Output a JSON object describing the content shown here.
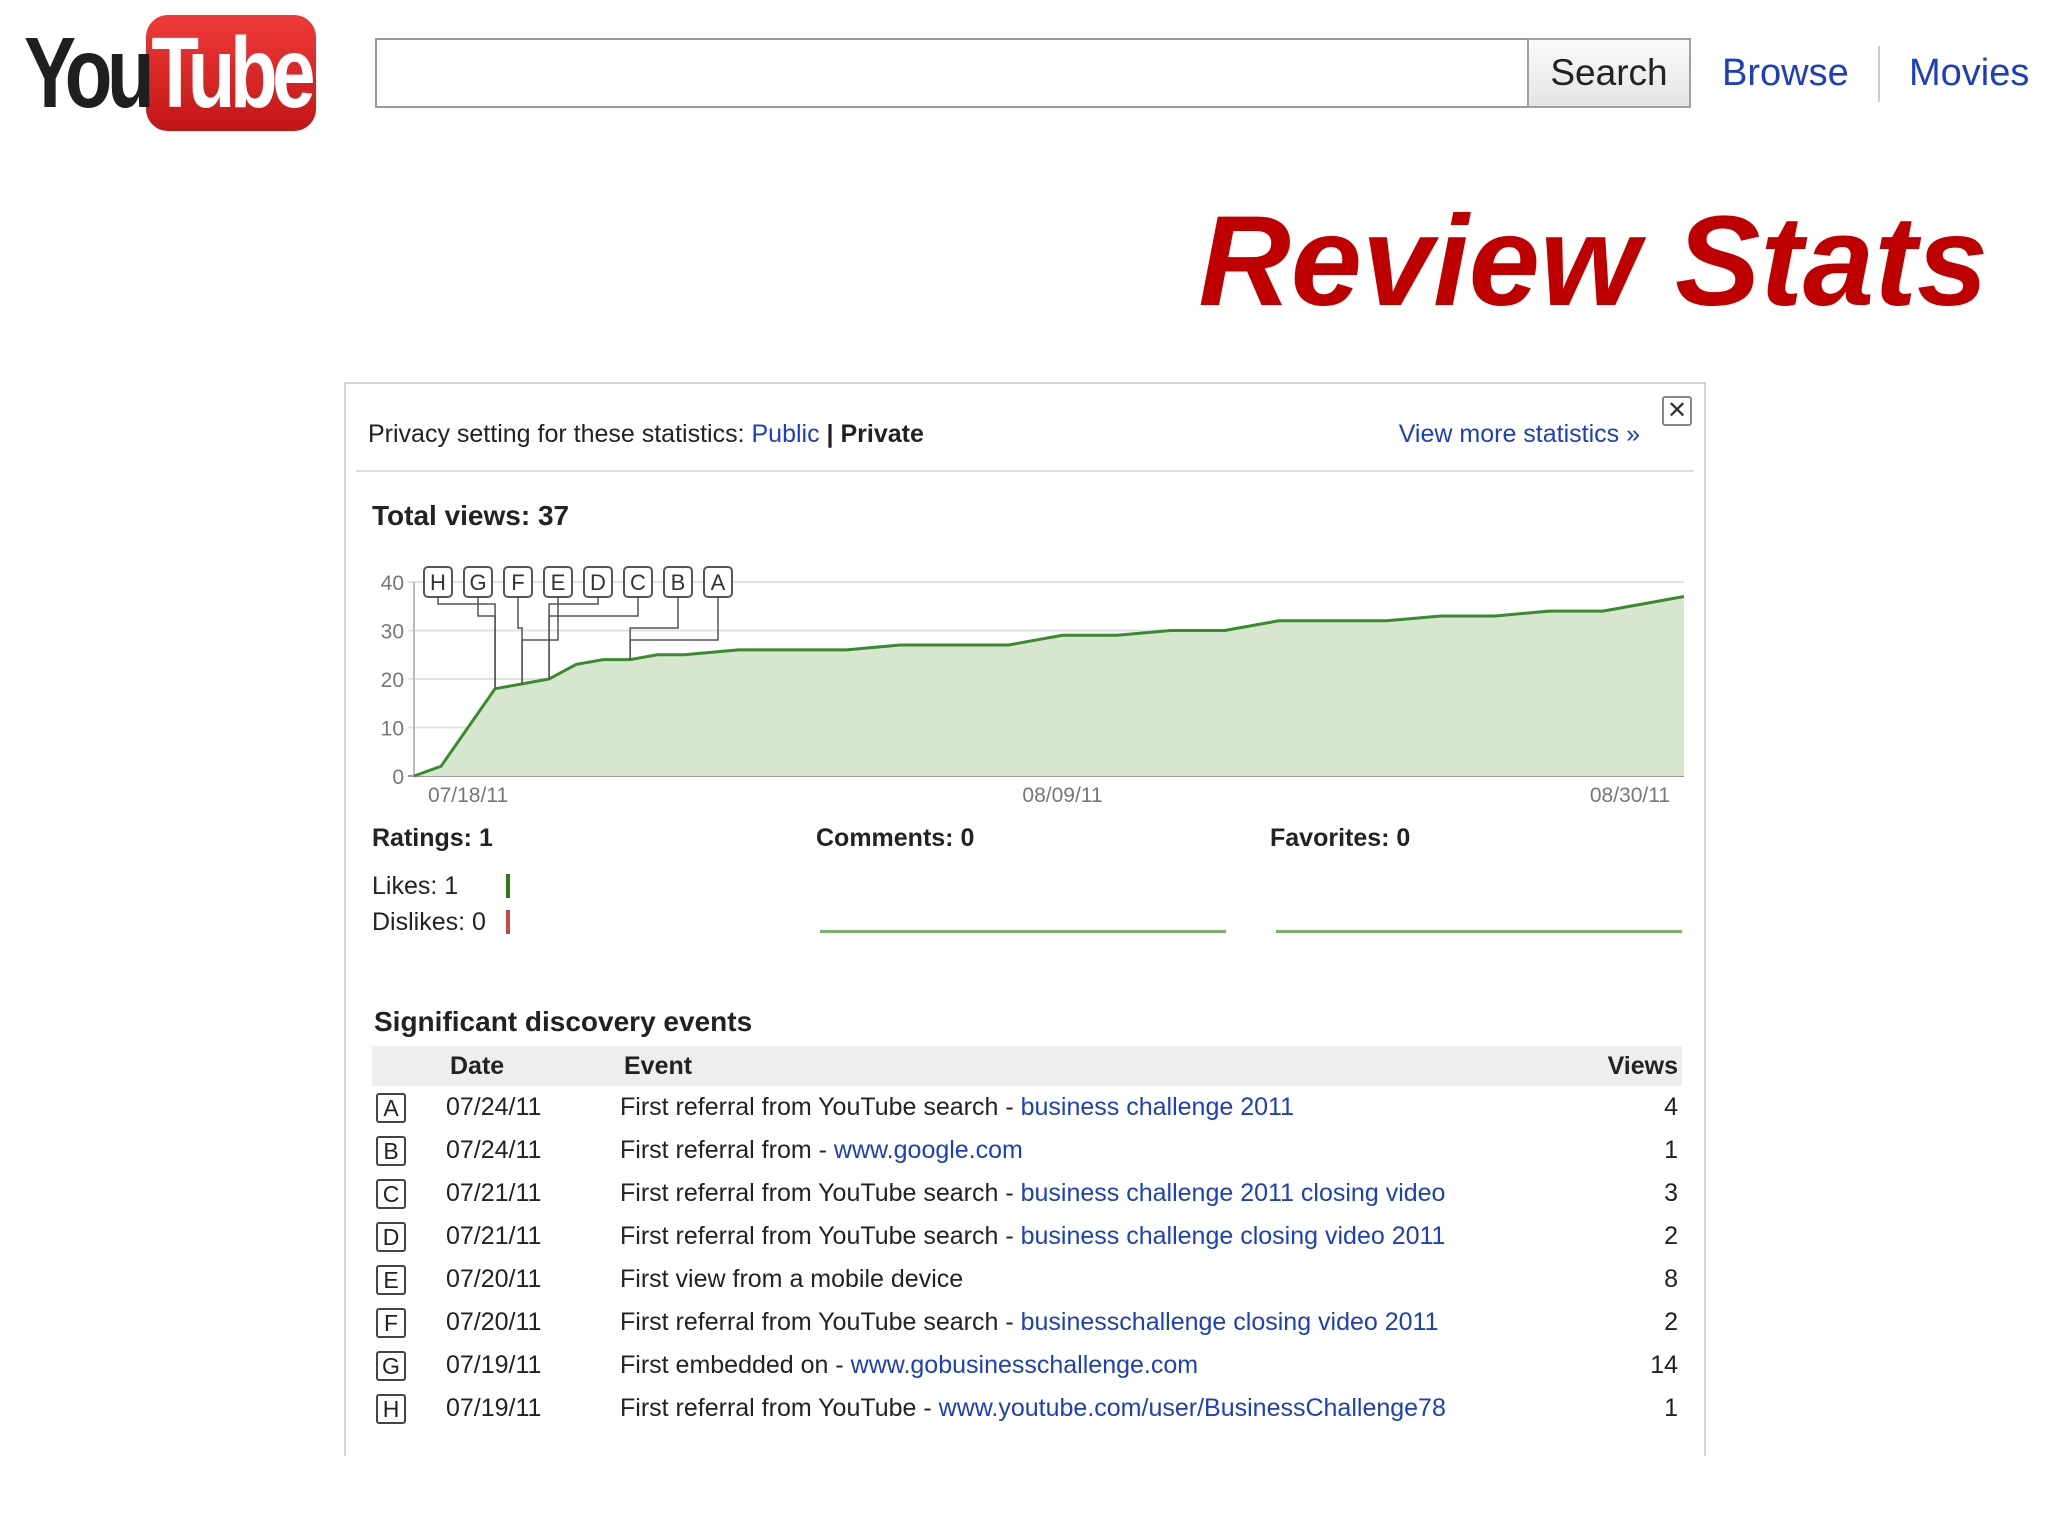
{
  "header": {
    "logo_you": "You",
    "logo_tube": "Tube",
    "search_button": "Search",
    "search_value": "",
    "nav": [
      "Browse",
      "Movies"
    ]
  },
  "slide_title": "Review Stats",
  "panel": {
    "privacy_label": "Privacy setting for these statistics:",
    "privacy_public": "Public",
    "privacy_sep": "|",
    "privacy_private": "Private",
    "view_more": "View more statistics »",
    "close": "✕",
    "total_views": "Total views: 37",
    "ratings": "Ratings: 1",
    "likes": "Likes: 1",
    "dislikes": "Dislikes: 0",
    "comments": "Comments: 0",
    "favorites": "Favorites: 0",
    "events_title": "Significant discovery events",
    "events_columns": {
      "date": "Date",
      "event": "Event",
      "views": "Views"
    },
    "events": [
      {
        "letter": "A",
        "date": "07/24/11",
        "text": "First referral from YouTube search - ",
        "link": "business challenge 2011",
        "views": "4"
      },
      {
        "letter": "B",
        "date": "07/24/11",
        "text": "First referral from - ",
        "link": "www.google.com",
        "views": "1"
      },
      {
        "letter": "C",
        "date": "07/21/11",
        "text": "First referral from YouTube search - ",
        "link": "business challenge 2011 closing video",
        "views": "3"
      },
      {
        "letter": "D",
        "date": "07/21/11",
        "text": "First referral from YouTube search - ",
        "link": "business challenge closing video 2011",
        "views": "2"
      },
      {
        "letter": "E",
        "date": "07/20/11",
        "text": "First view from a mobile device",
        "link": "",
        "views": "8"
      },
      {
        "letter": "F",
        "date": "07/20/11",
        "text": "First referral from YouTube search - ",
        "link": "businesschallenge closing video 2011",
        "views": "2"
      },
      {
        "letter": "G",
        "date": "07/19/11",
        "text": "First embedded on - ",
        "link": "www.gobusinesschallenge.com",
        "views": "14"
      },
      {
        "letter": "H",
        "date": "07/19/11",
        "text": "First referral from YouTube - ",
        "link": "www.youtube.com/user/BusinessChallenge78",
        "views": "1"
      }
    ]
  },
  "chart_data": {
    "type": "area",
    "title": "",
    "xlabel": "",
    "ylabel": "",
    "ylim": [
      0,
      40
    ],
    "yticks": [
      0,
      10,
      20,
      30,
      40
    ],
    "xticks": [
      "07/18/11",
      "08/09/11",
      "08/30/11"
    ],
    "grid": true,
    "colors": {
      "line": "#3a8a2e",
      "fill": "#d6e6cf"
    },
    "markers": [
      "H",
      "G",
      "F",
      "E",
      "D",
      "C",
      "B",
      "A"
    ],
    "series": [
      {
        "x": [
          "07/16/11",
          "07/17/11",
          "07/18/11",
          "07/19/11",
          "07/20/11",
          "07/21/11",
          "07/22/11",
          "07/23/11",
          "07/24/11",
          "07/25/11",
          "07/26/11",
          "07/28/11",
          "07/30/11",
          "08/01/11",
          "08/03/11",
          "08/05/11",
          "08/07/11",
          "08/09/11",
          "08/11/11",
          "08/13/11",
          "08/15/11",
          "08/17/11",
          "08/19/11",
          "08/21/11",
          "08/23/11",
          "08/25/11",
          "08/27/11",
          "08/29/11",
          "08/31/11",
          "09/01/11"
        ],
        "values": [
          0,
          2,
          10,
          18,
          19,
          20,
          23,
          24,
          24,
          25,
          25,
          26,
          26,
          26,
          27,
          27,
          27,
          29,
          29,
          30,
          30,
          32,
          32,
          32,
          33,
          33,
          34,
          34,
          36,
          37
        ]
      }
    ]
  }
}
